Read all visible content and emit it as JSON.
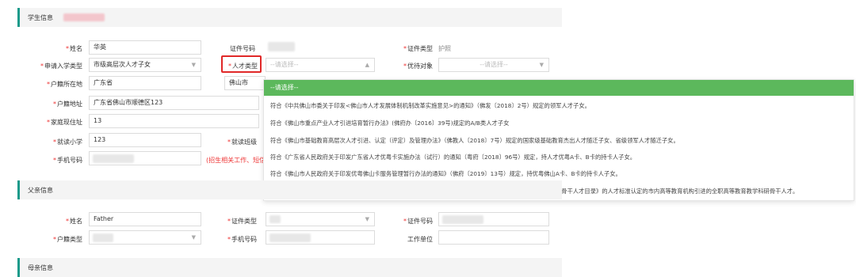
{
  "student_section": {
    "title": "学生信息"
  },
  "father_section": {
    "title": "父亲信息"
  },
  "mother_section": {
    "title": "母亲信息"
  },
  "student": {
    "name_label": "姓名",
    "name_value": "华英",
    "id_no_label": "证件号码",
    "id_type_label": "证件类型",
    "id_type_value": "护照",
    "apply_type_label": "申请入学类型",
    "apply_type_value": "市级高层次人才子女",
    "talent_type_label": "人才类型",
    "talent_type_placeholder": "--请选择--",
    "priority_label": "优待对象",
    "priority_placeholder": "--请选择--",
    "hukou_loc_label": "户籍所在地",
    "hukou_loc_value": "广东省",
    "hukou_city_value": "佛山市",
    "hukou_addr_label": "户籍地址",
    "hukou_addr_value": "广东省佛山市顺德区123",
    "home_addr_label": "家庭现住址",
    "home_addr_value": "13",
    "school_label": "就读小学",
    "school_value": "123",
    "class_label": "就读班级",
    "phone_label": "手机号码",
    "phone_hint": "(招生相关工作、短信"
  },
  "dropdown": {
    "header": "--请选择--",
    "options": [
      "符合《中共佛山市委关于印发<佛山市人才发展体制机制改革实施意见>的通知》（佛发〔2018〕2号）规定的领军人才子女。",
      "符合《佛山市重点产业人才引进培育暂行办法》(佛府办〔2016〕39号)规定的A/B类人才子女",
      "符合《佛山市基础教育高层次人才引进、认定（评定）及管理办法》（佛教人〔2018〕7号）规定的国家级基础教育杰出人才随迁子女、省级领军人才随迁子女。",
      "符合《广东省人民政府关于印发广东省人才优粤卡实施办法（试行）的通知（粤府〔2018〕96号）规定，持人才优粤A卡、B卡的持卡人子女。",
      "符合《佛山市人民政府关于印发优粤佛山卡服务管理暂行办法的通知》（佛府〔2019〕13号）规定，持优粤佛山A卡、B卡的持卡人子女。",
      "符合《佛山市高等教育高层次人才引进扶持办法》（佛府办〔2018〕38号）规定的按照《佛山市高等教育教学科研骨干人才目录》的人才标准认定的市内高等教育机构引进的全职高等教育教学科研骨干人才。"
    ]
  },
  "father": {
    "name_label": "姓名",
    "name_value": "Father",
    "id_type_label": "证件类型",
    "id_no_label": "证件号码",
    "hukou_type_label": "户籍类型",
    "phone_label": "手机号码",
    "work_label": "工作单位"
  },
  "colors": {
    "accent": "#1a9a8a",
    "dropdown_header": "#5cb85c",
    "required": "#e33333",
    "highlight": "#e02828"
  }
}
